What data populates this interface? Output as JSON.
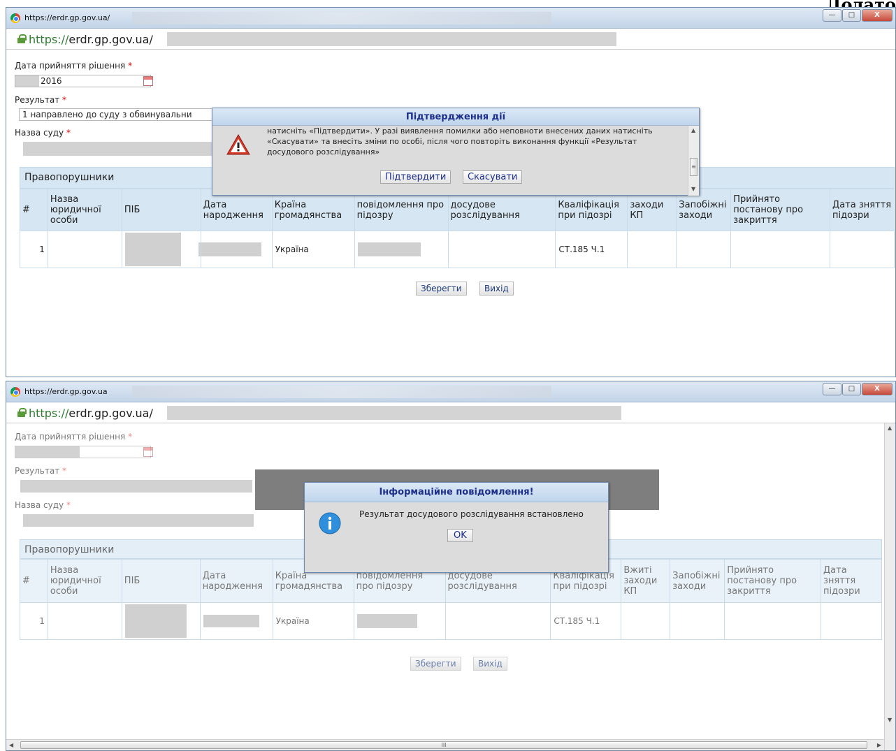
{
  "corner_text": "Додато",
  "window1": {
    "title_url": "https://erdr.gp.gov.ua/",
    "address": {
      "scheme": "https://",
      "domain": "erdr.gp.gov.ua",
      "slash": "/"
    },
    "form": {
      "date_label": "Дата прийняття рішення",
      "date_value": "2016",
      "result_label": "Результат",
      "result_value": "1 направлено до суду з обвинувальни",
      "court_label": "Назва суду",
      "required_mark": "*"
    },
    "dialog": {
      "title": "Підтвердження дії",
      "text": "натисніть «Підтвердити». У разі виявлення помилки або неповноти внесених даних натисніть «Скасувати» та внесіть зміни по особі, після чого повторіть виконання функції «Результат досудового розслідування»",
      "confirm": "Підтвердити",
      "cancel": "Скасувати"
    },
    "grid": {
      "title": "Правопорушники",
      "headers": [
        "#",
        "Назва юридичної особи",
        "ПІБ",
        "Дата народження",
        "Країна громадянства",
        "повідомлення про підозру",
        "досудове розслідування",
        "Кваліфікація при підозрі",
        "заходи КП",
        "Запобіжні заходи",
        "Прийнято постанову про закриття",
        "Дата зняття підозри"
      ],
      "row": {
        "num": "1",
        "country": "Україна",
        "qualification": "СТ.185 Ч.1"
      }
    },
    "buttons": {
      "save": "Зберегти",
      "exit": "Вихід"
    }
  },
  "window2": {
    "title_url": "https://erdr.gp.gov.ua",
    "address": {
      "scheme": "https://",
      "domain": "erdr.gp.gov.ua",
      "slash": "/"
    },
    "form": {
      "date_label": "Дата прийняття рішення",
      "result_label": "Результат",
      "court_label": "Назва суду",
      "required_mark": "*"
    },
    "dialog": {
      "title": "Інформаційне повідомлення!",
      "text": "Результат досудового розслідування встановлено",
      "ok": "OK"
    },
    "grid": {
      "title": "Правопорушники",
      "headers": [
        "#",
        "Назва юридичної особи",
        "ПІБ",
        "Дата народження",
        "Країна громадянства",
        "повідомлення про підозру",
        "досудове розслідування",
        "Кваліфікація при підозрі",
        "Вжиті заходи КП",
        "Запобіжні заходи",
        "Прийнято постанову про закриття",
        "Дата зняття підозри"
      ],
      "row": {
        "num": "1",
        "country": "Україна",
        "qualification": "СТ.185 Ч.1"
      }
    },
    "buttons": {
      "save": "Зберегти",
      "exit": "Вихід"
    },
    "scroll_glyph": "III"
  },
  "colors": {
    "accent": "#1d2f8a",
    "grid_header": "#d6e6f2",
    "required": "#dd0000"
  }
}
